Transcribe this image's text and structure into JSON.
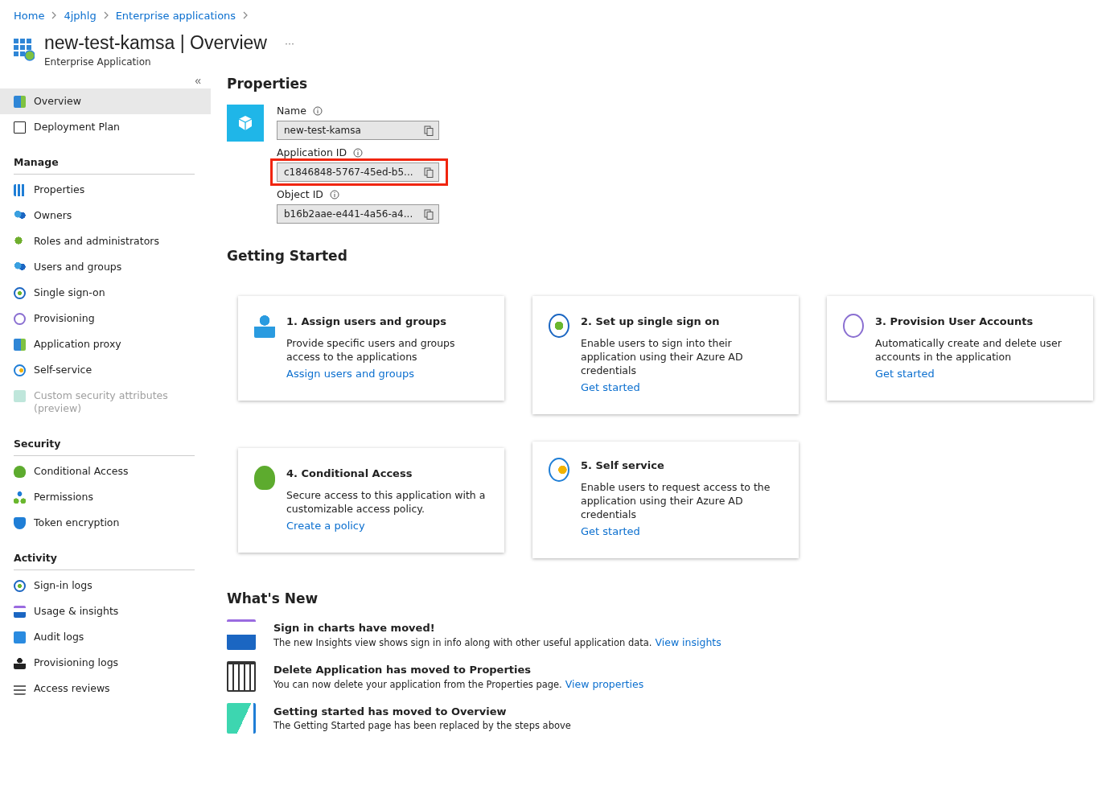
{
  "breadcrumb": [
    "Home",
    "4jphlg",
    "Enterprise applications"
  ],
  "header": {
    "title": "new-test-kamsa | Overview",
    "subtitle": "Enterprise Application",
    "more": "···"
  },
  "sidebar": {
    "collapse": "«",
    "top_items": [
      {
        "label": "Overview",
        "selected": true,
        "disabled": false
      },
      {
        "label": "Deployment Plan",
        "selected": false,
        "disabled": false
      }
    ],
    "sections": [
      {
        "title": "Manage",
        "items": [
          {
            "label": "Properties",
            "selected": false,
            "disabled": false
          },
          {
            "label": "Owners",
            "selected": false,
            "disabled": false
          },
          {
            "label": "Roles and administrators",
            "selected": false,
            "disabled": false
          },
          {
            "label": "Users and groups",
            "selected": false,
            "disabled": false
          },
          {
            "label": "Single sign-on",
            "selected": false,
            "disabled": false
          },
          {
            "label": "Provisioning",
            "selected": false,
            "disabled": false
          },
          {
            "label": "Application proxy",
            "selected": false,
            "disabled": false
          },
          {
            "label": "Self-service",
            "selected": false,
            "disabled": false
          },
          {
            "label": "Custom security attributes (preview)",
            "selected": false,
            "disabled": true
          }
        ]
      },
      {
        "title": "Security",
        "items": [
          {
            "label": "Conditional Access",
            "selected": false,
            "disabled": false
          },
          {
            "label": "Permissions",
            "selected": false,
            "disabled": false
          },
          {
            "label": "Token encryption",
            "selected": false,
            "disabled": false
          }
        ]
      },
      {
        "title": "Activity",
        "items": [
          {
            "label": "Sign-in logs",
            "selected": false,
            "disabled": false
          },
          {
            "label": "Usage & insights",
            "selected": false,
            "disabled": false
          },
          {
            "label": "Audit logs",
            "selected": false,
            "disabled": false
          },
          {
            "label": "Provisioning logs",
            "selected": false,
            "disabled": false
          },
          {
            "label": "Access reviews",
            "selected": false,
            "disabled": false
          }
        ]
      }
    ]
  },
  "properties": {
    "title": "Properties",
    "fields": [
      {
        "label": "Name",
        "value": "new-test-kamsa",
        "highlighted": false
      },
      {
        "label": "Application ID",
        "value": "c1846848-5767-45ed-b5...",
        "highlighted": true
      },
      {
        "label": "Object ID",
        "value": "b16b2aae-e441-4a56-a4...",
        "highlighted": false
      }
    ]
  },
  "getting_started": {
    "title": "Getting Started",
    "cards": [
      {
        "title": "1. Assign users and groups",
        "text": "Provide specific users and groups access to the applications",
        "link": "Assign users and groups"
      },
      {
        "title": "2. Set up single sign on",
        "text": "Enable users to sign into their application using their Azure AD credentials",
        "link": "Get started"
      },
      {
        "title": "3. Provision User Accounts",
        "text": "Automatically create and delete user accounts in the application",
        "link": "Get started"
      },
      {
        "title": "4. Conditional Access",
        "text": "Secure access to this application with a customizable access policy.",
        "link": "Create a policy"
      },
      {
        "title": "5. Self service",
        "text": "Enable users to request access to the application using their Azure AD credentials",
        "link": "Get started"
      }
    ]
  },
  "whats_new": {
    "title": "What's New",
    "items": [
      {
        "title": "Sign in charts have moved!",
        "text": "The new Insights view shows sign in info along with other useful application data.",
        "link": "View insights"
      },
      {
        "title": "Delete Application has moved to Properties",
        "text": "You can now delete your application from the Properties page.",
        "link": "View properties"
      },
      {
        "title": "Getting started has moved to Overview",
        "text": "The Getting Started page has been replaced by the steps above"
      }
    ]
  }
}
